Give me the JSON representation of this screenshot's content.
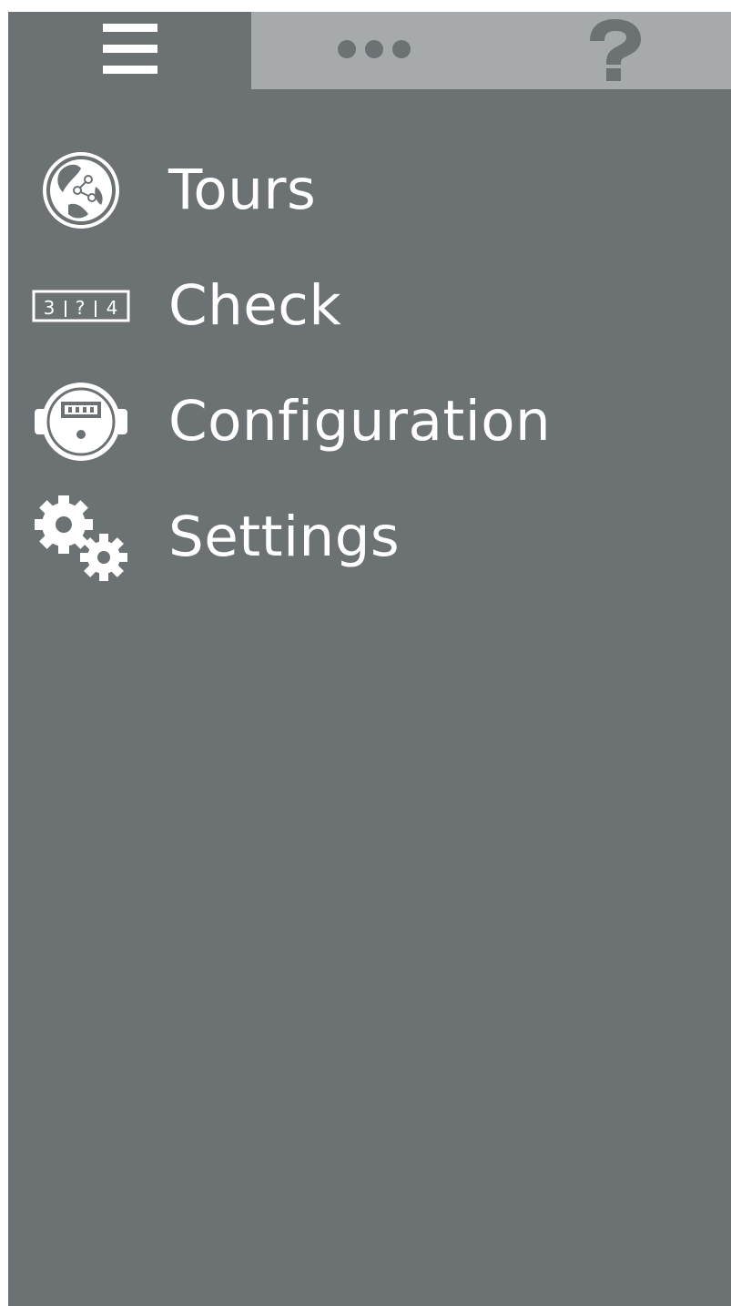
{
  "tabs": {
    "menu": {
      "icon": "hamburger-menu-icon"
    },
    "more": {
      "icon": "more-dots-icon"
    },
    "help": {
      "icon": "question-mark-icon"
    }
  },
  "menu": {
    "items": [
      {
        "label": "Tours",
        "icon": "tours-globe-icon"
      },
      {
        "label": "Check",
        "icon": "check-counter-icon"
      },
      {
        "label": "Configuration",
        "icon": "meter-device-icon"
      },
      {
        "label": "Settings",
        "icon": "gears-icon"
      }
    ]
  },
  "colors": {
    "panel": "#6c7174",
    "tab_inactive": "#a7aaad",
    "text": "#ffffff"
  }
}
